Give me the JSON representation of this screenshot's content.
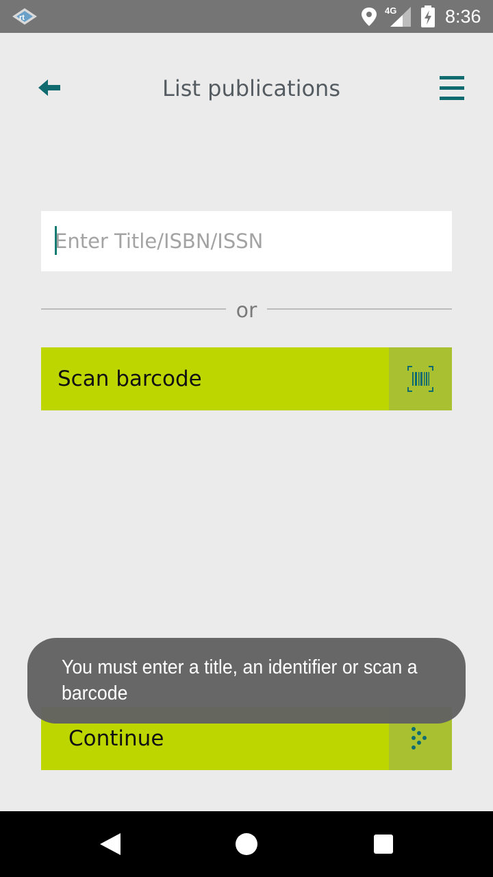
{
  "status_bar": {
    "time": "8:36",
    "network": "4G",
    "icons": [
      "app-logo-icon",
      "location-icon",
      "signal-icon",
      "battery-charging-icon"
    ]
  },
  "header": {
    "title": "List publications",
    "back_icon": "arrow-left-icon",
    "menu_icon": "hamburger-menu-icon"
  },
  "search": {
    "placeholder": "Enter Title/ISBN/ISSN",
    "value": ""
  },
  "divider": {
    "text": "or"
  },
  "scan_button": {
    "label": "Scan barcode",
    "icon": "barcode-scan-icon"
  },
  "continue_button": {
    "label": "Continue",
    "icon": "dotted-arrow-right-icon"
  },
  "toast": {
    "message": "You must enter a title, an identifier or scan a barcode"
  },
  "nav_bar": {
    "icons": [
      "back-triangle-icon",
      "home-circle-icon",
      "recents-square-icon"
    ]
  },
  "colors": {
    "accent": "#bed600",
    "accent_dark": "#a9c130",
    "teal": "#0f6b70",
    "background": "#ebebeb",
    "status_bar": "#757575",
    "toast": "#616161"
  }
}
